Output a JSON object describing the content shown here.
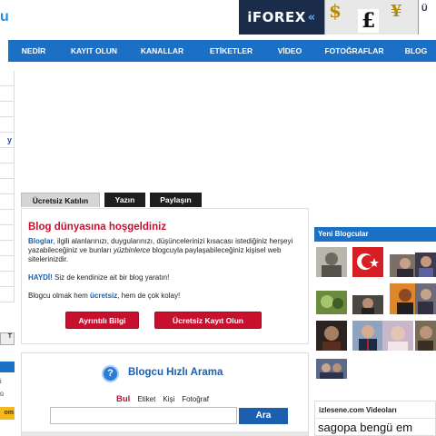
{
  "header": {
    "logo_fragment": "u",
    "ad": {
      "brand": "iFOREX",
      "chevron": "«",
      "sym_dollar": "$",
      "sym_pound": "£",
      "sym_yen": "¥",
      "right_text": "Ü"
    }
  },
  "nav": {
    "items": [
      {
        "label": "NEDİR"
      },
      {
        "label": "KAYIT OLUN"
      },
      {
        "label": "KANALLAR"
      },
      {
        "label": "ETİKETLER"
      },
      {
        "label": "VİDEO"
      },
      {
        "label": "FOTOĞRAFLAR"
      },
      {
        "label": "BLOG"
      }
    ]
  },
  "left_sidebar": {
    "selected_marker": "y",
    "bottom_button": "T",
    "frag_1": "i",
    "frag_2": "ü",
    "yellow_text": "om"
  },
  "tabs": [
    {
      "label": "Ücretsiz Katılın"
    },
    {
      "label": "Yazın"
    },
    {
      "label": "Paylaşın"
    }
  ],
  "welcome": {
    "title": "Blog dünyasına hoşgeldiniz",
    "text_bold": "Bloglar",
    "text_part1": ", ilgili alanlarınızı, duygularınızı, düşüncelerinizi kısacası istediğiniz herşeyi yazabileceğiniz ve bunları ",
    "text_italic": "yüzbinlerce",
    "text_part2": " blogcuyla paylaşabileceğiniz kişisel web sitelerinizdir.",
    "haydi_bold": "HAYDİ!",
    "haydi_text": " Siz de kendinize ait bir blog yaratın!",
    "easy_prefix": "Blogcu olmak hem ",
    "easy_bold": "ücretsiz",
    "easy_suffix": ", hem de çok kolay!",
    "btn_info": "Ayrıntılı Bilgi",
    "btn_register": "Ücretsiz Kayıt Olun"
  },
  "search": {
    "icon_glyph": "?",
    "title": "Blogcu Hızlı Arama",
    "options": [
      {
        "label": "Bul"
      },
      {
        "label": "Etiket"
      },
      {
        "label": "Kişi"
      },
      {
        "label": "Fotoğraf"
      }
    ],
    "input_value": "",
    "button_label": "Ara"
  },
  "new_bloggers": {
    "title": "Yeni Blogcular"
  },
  "videos": {
    "title": "izlesene.com Videoları",
    "first_item": "sagopa bengü em"
  },
  "colors": {
    "nav_blue": "#1b6fc4",
    "accent_red": "#c8102e",
    "link_blue": "#1b5fae",
    "tab_dark": "#1e1e1e"
  }
}
